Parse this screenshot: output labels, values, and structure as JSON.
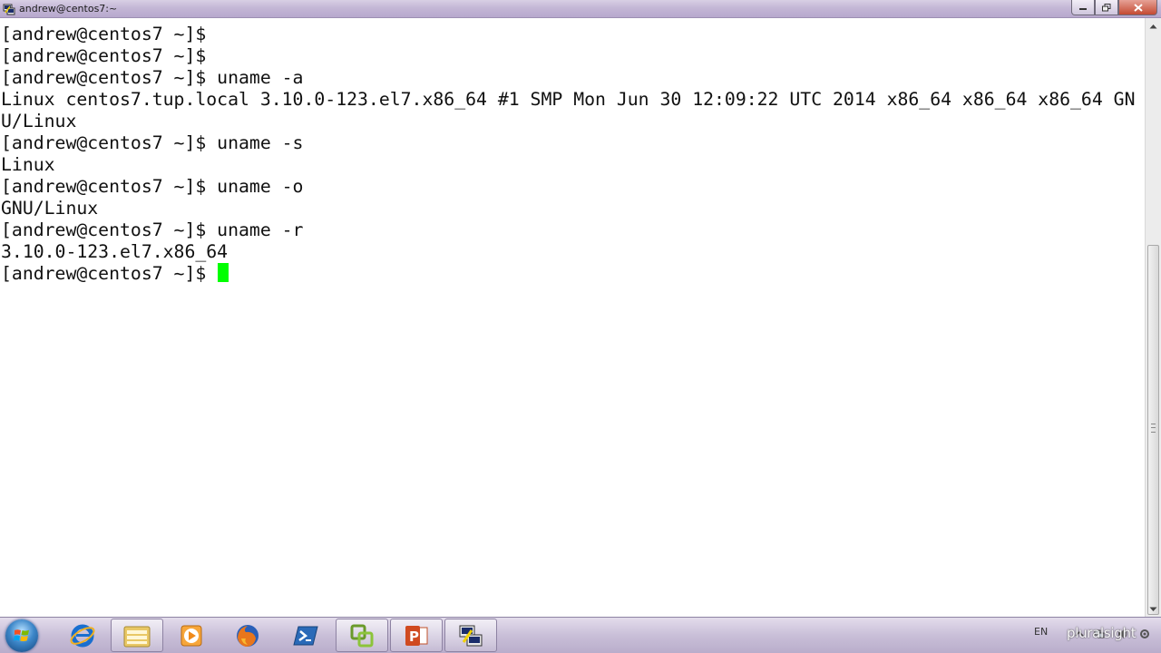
{
  "window": {
    "title": "andrew@centos7:~"
  },
  "terminal": {
    "lines": [
      "[andrew@centos7 ~]$",
      "[andrew@centos7 ~]$",
      "[andrew@centos7 ~]$ uname -a",
      "Linux centos7.tup.local 3.10.0-123.el7.x86_64 #1 SMP Mon Jun 30 12:09:22 UTC 2014 x86_64 x86_64 x86_64 GN",
      "U/Linux",
      "[andrew@centos7 ~]$ uname -s",
      "Linux",
      "[andrew@centos7 ~]$ uname -o",
      "GNU/Linux",
      "[andrew@centos7 ~]$ uname -r",
      "3.10.0-123.el7.x86_64",
      "[andrew@centos7 ~]$ "
    ],
    "cursor_color": "#00ff00",
    "text_color": "#111111",
    "background": "#ffffff"
  },
  "taskbar": {
    "items": [
      {
        "name": "start-button",
        "icon": "windows-orb-icon"
      },
      {
        "name": "internet-explorer",
        "icon": "ie-icon"
      },
      {
        "name": "windows-explorer",
        "icon": "folder-icon"
      },
      {
        "name": "media-player",
        "icon": "media-player-icon"
      },
      {
        "name": "firefox",
        "icon": "firefox-icon"
      },
      {
        "name": "powershell",
        "icon": "powershell-icon"
      },
      {
        "name": "vsphere-client",
        "icon": "vsphere-icon"
      },
      {
        "name": "powerpoint",
        "icon": "powerpoint-icon"
      },
      {
        "name": "putty",
        "icon": "putty-icon"
      }
    ],
    "language": "EN",
    "watermark": "pluralsight"
  }
}
